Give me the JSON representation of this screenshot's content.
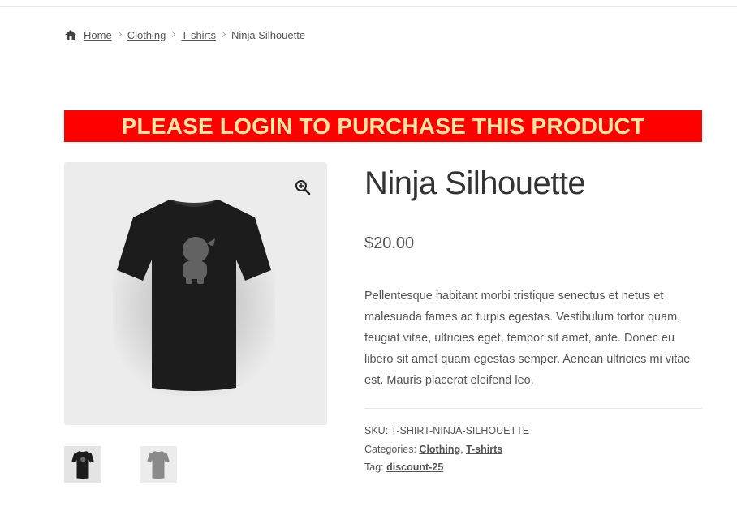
{
  "breadcrumb": {
    "home": "Home",
    "items": [
      "Clothing",
      "T-shirts"
    ],
    "current": "Ninja Silhouette"
  },
  "banner": {
    "text": "PLEASE LOGIN TO PURCHASE THIS PRODUCT",
    "background": "#ff0000",
    "text_color": "#ffe6a5"
  },
  "product": {
    "title": "Ninja Silhouette",
    "price": "$20.00",
    "description": "Pellentesque habitant morbi tristique senectus et netus et malesuada fames ac turpis egestas. Vestibulum tortor quam, feugiat vitae, ultricies eget, tempor sit amet, ante. Donec eu libero sit amet quam egestas semper. Aenean ultricies mi vitae est. Mauris placerat eleifend leo.",
    "sku_label": "SKU:",
    "sku": "T-SHIRT-NINJA-SILHOUETTE",
    "categories_label": "Categories:",
    "categories": [
      "Clothing",
      "T-shirts"
    ],
    "tag_label": "Tag:",
    "tag": "discount-25"
  },
  "icons": {
    "home": "home-icon",
    "zoom": "zoom-in-icon"
  }
}
